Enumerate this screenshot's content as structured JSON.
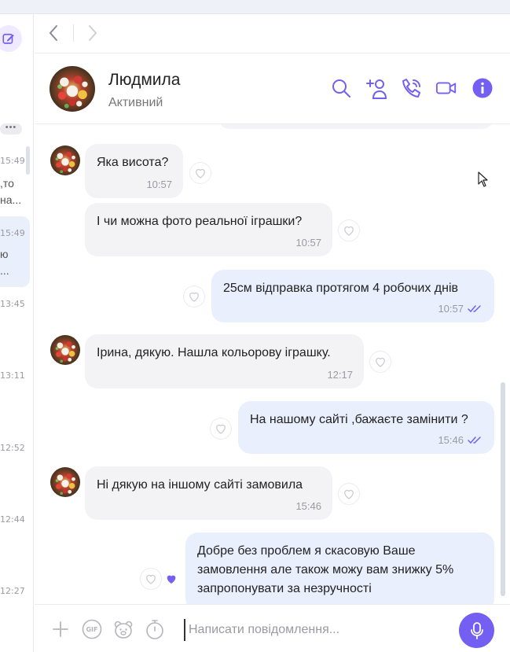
{
  "colors": {
    "accent": "#7360f2",
    "incoming_bubble": "#f3f3f5",
    "outgoing_bubble": "#e9effc"
  },
  "chat_list": {
    "items": [
      {
        "time": "15:49",
        "preview": [
          ",то",
          "на..."
        ]
      },
      {
        "time": "15:49",
        "preview": [
          "ю",
          "..."
        ]
      },
      {
        "time": "13:45"
      },
      {
        "time": "13:11"
      },
      {
        "time": "12:52"
      },
      {
        "time": "12:44"
      },
      {
        "time": "12:27"
      }
    ]
  },
  "header": {
    "name": "Людмила",
    "status": "Активний"
  },
  "messages": [
    {
      "dir": "in",
      "text": "Яка висота?",
      "time": "10:57"
    },
    {
      "dir": "in",
      "text": "І чи можна фото реальної іграшки?",
      "time": "10:57"
    },
    {
      "dir": "out",
      "text": "25см відправка протягом 4 робочих днів",
      "time": "10:57"
    },
    {
      "dir": "in",
      "text": "Ірина, дякую. Нашла кольорову іграшку.",
      "time": "12:17"
    },
    {
      "dir": "out",
      "text": "На нашому сайті ,бажаєте замінити ?",
      "time": "15:46"
    },
    {
      "dir": "in",
      "text": "Ні дякую на іншому сайті замовила",
      "time": "15:46"
    },
    {
      "dir": "out",
      "lines": [
        "Добре без проблем я скасовую Ваше",
        "замовлення але також можу вам знижку 5%",
        "запропонувати за незручності"
      ]
    }
  ],
  "composer": {
    "placeholder": "Написати повідомлення...",
    "gif_label": "GIF"
  }
}
